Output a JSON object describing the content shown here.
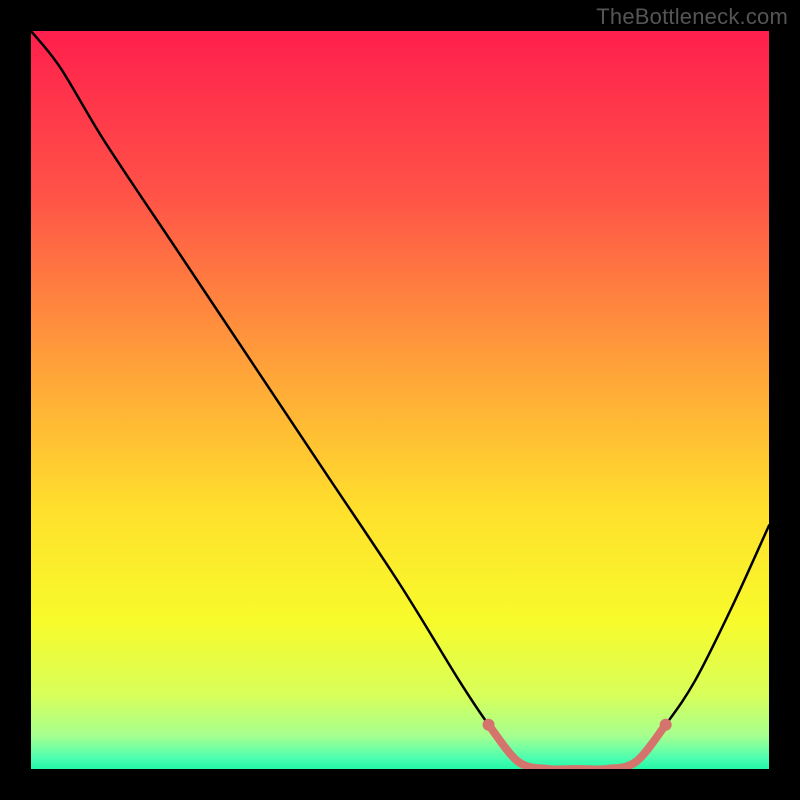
{
  "watermark": "TheBottleneck.com",
  "chart_data": {
    "type": "line",
    "title": "",
    "xlabel": "",
    "ylabel": "",
    "xlim": [
      0,
      100
    ],
    "ylim": [
      0,
      100
    ],
    "x": [
      0,
      4,
      10,
      20,
      30,
      40,
      50,
      58,
      62,
      66,
      70,
      74,
      78,
      82,
      86,
      90,
      95,
      100
    ],
    "values": [
      100,
      95,
      85,
      70,
      55,
      40,
      25,
      12,
      6,
      1,
      0,
      0,
      0,
      1,
      6,
      12,
      22,
      33
    ],
    "curve_color": "#000000",
    "highlight": {
      "x_start": 62,
      "x_end": 86,
      "point_color": "#d5746d",
      "stroke_color": "#d5746d",
      "stroke_width": 8
    },
    "background_gradient": [
      {
        "offset": 0.0,
        "color": "#ff1f4d"
      },
      {
        "offset": 0.22,
        "color": "#ff5247"
      },
      {
        "offset": 0.45,
        "color": "#ffa03a"
      },
      {
        "offset": 0.65,
        "color": "#ffe02c"
      },
      {
        "offset": 0.8,
        "color": "#f7fb2b"
      },
      {
        "offset": 0.9,
        "color": "#d8ff5a"
      },
      {
        "offset": 0.955,
        "color": "#a6ff8f"
      },
      {
        "offset": 0.985,
        "color": "#4dffb0"
      },
      {
        "offset": 1.0,
        "color": "#22f7a8"
      }
    ]
  }
}
